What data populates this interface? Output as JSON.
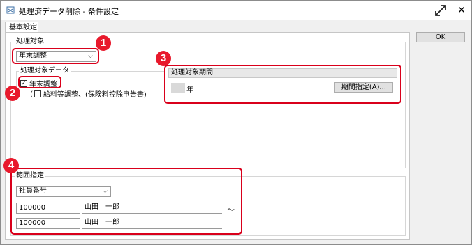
{
  "window": {
    "title": "処理済データ削除 - 条件設定",
    "maximize_icon": "⤢",
    "close_icon": "✕"
  },
  "tabs": [
    {
      "label": "基本設定"
    }
  ],
  "ok_button": {
    "label": "OK"
  },
  "target": {
    "group_label": "処理対象",
    "selected": "年末調整",
    "data_group_label": "処理対象データ",
    "checkbox_year_end": {
      "label": "年末調整",
      "checked": true
    },
    "paren_open": "（",
    "checkbox_salary": {
      "label": "給料等調整、(保険料控除申告書)",
      "checked": false
    }
  },
  "period": {
    "header": "処理対象期間",
    "year_suffix": "年",
    "button_label": "期間指定(A)..."
  },
  "range": {
    "group_label": "範囲指定",
    "selected": "社員番号",
    "from": {
      "code": "100000",
      "name": "山田　一郎"
    },
    "tilde": "～",
    "to": {
      "code": "100000",
      "name": "山田　一郎"
    }
  },
  "badges": [
    "1",
    "2",
    "3",
    "4"
  ],
  "colors": {
    "highlight": "#d9001b",
    "badge": "#e8192c",
    "window_bg": "#f0f0f0"
  }
}
